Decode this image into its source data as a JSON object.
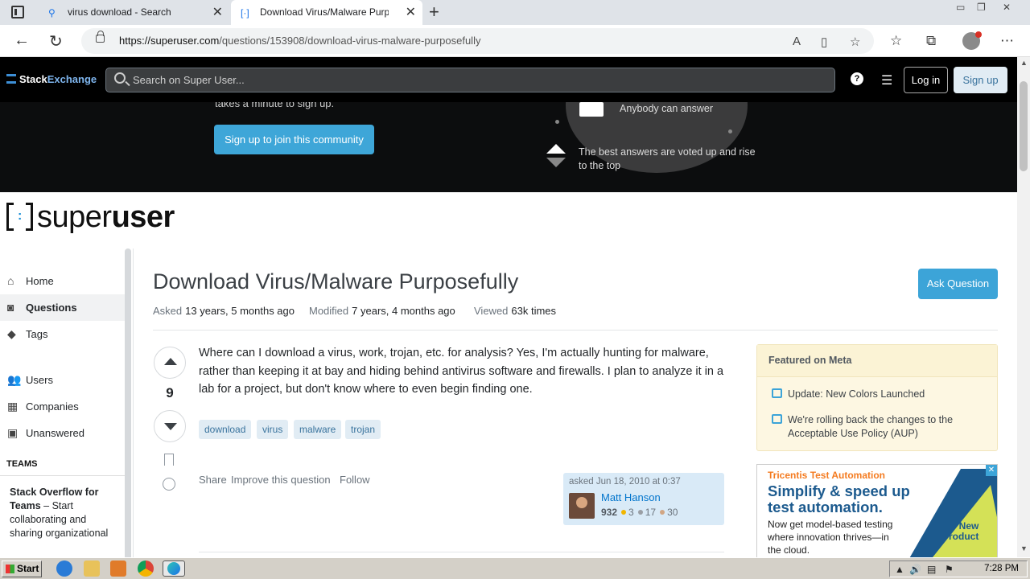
{
  "browser": {
    "tabs": [
      {
        "title": "virus download - Search"
      },
      {
        "title": "Download Virus/Malware Purpos"
      }
    ],
    "url_domain": "https://superuser.com",
    "url_path": "/questions/153908/download-virus-malware-purposefully"
  },
  "se_header": {
    "logo_stack": "Stack",
    "logo_exchange": "Exchange",
    "search_placeholder": "Search on Super User...",
    "login_label": "Log in",
    "signup_label": "Sign up"
  },
  "banner": {
    "signup_text": "takes a minute to sign up.",
    "join_button": "Sign up to join this community",
    "anybody_answer": "Anybody can answer",
    "best_answers": "The best answers are voted up and rise to the top"
  },
  "site": {
    "logo_super": "super",
    "logo_user": "user"
  },
  "left_nav": {
    "items": [
      {
        "label": "Home"
      },
      {
        "label": "Questions"
      },
      {
        "label": "Tags"
      },
      {
        "label": "Users"
      },
      {
        "label": "Companies"
      },
      {
        "label": "Unanswered"
      }
    ],
    "teams_heading": "TEAMS",
    "teams_title": "Stack Overflow for Teams",
    "teams_body": "– Start collaborating and sharing organizational"
  },
  "question": {
    "title": "Download Virus/Malware Purposefully",
    "ask_button": "Ask Question",
    "asked_label": "Asked",
    "asked_value": "13 years, 5 months ago",
    "modified_label": "Modified",
    "modified_value": "7 years, 4 months ago",
    "viewed_label": "Viewed",
    "viewed_value": "63k times",
    "votes": "9",
    "body": "Where can I download a virus, work, trojan, etc. for analysis? Yes, I'm actually hunting for malware, rather than keeping it at bay and hiding behind antivirus software and firewalls. I plan to analyze it in a lab for a project, but don't know where to even begin finding one.",
    "tags": [
      "download",
      "virus",
      "malware",
      "trojan"
    ],
    "menu": {
      "share": "Share",
      "improve": "Improve this question",
      "follow": "Follow"
    },
    "asker": {
      "asked_text": "asked Jun 18, 2010 at 0:37",
      "name": "Matt Hanson",
      "reputation": "932",
      "gold": "3",
      "silver": "17",
      "bronze": "30"
    }
  },
  "sidebar": {
    "featured_heading": "Featured on Meta",
    "featured_items": [
      {
        "text": "Update: New Colors Launched"
      },
      {
        "text": "We're rolling back the changes to the Acceptable Use Policy (AUP)"
      }
    ],
    "ad": {
      "brand": "Tricentis Test Automation",
      "headline": "Simplify & speed up test automation.",
      "body": "Now get model-based testing where innovation thrives—in the cloud.",
      "badge_line1": "New",
      "badge_line2": "Product"
    }
  },
  "taskbar": {
    "start_label": "Start",
    "clock": "7:28 PM"
  },
  "colors": {
    "accent_blue": "#3ca4d8",
    "link_blue": "#0074cc",
    "tag_bg": "#e1ecf4",
    "featured_bg": "#fdf7e2",
    "badge_gold": "#f1b600",
    "badge_silver": "#9a9fa5",
    "badge_bronze": "#d1a684"
  }
}
